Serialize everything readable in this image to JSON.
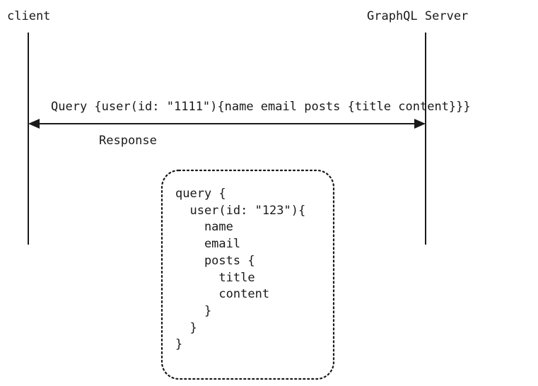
{
  "participants": {
    "client": "client",
    "server": "GraphQL Server"
  },
  "messages": {
    "query": "Query {user(id: \"1111\"){name email posts {title content}}}",
    "response": "Response"
  },
  "note": {
    "code": "query {\n  user(id: \"123\"){\n    name\n    email\n    posts {\n      title\n      content\n    }\n  }\n}"
  },
  "colors": {
    "ink": "#1a1a1a",
    "background": "#ffffff"
  }
}
